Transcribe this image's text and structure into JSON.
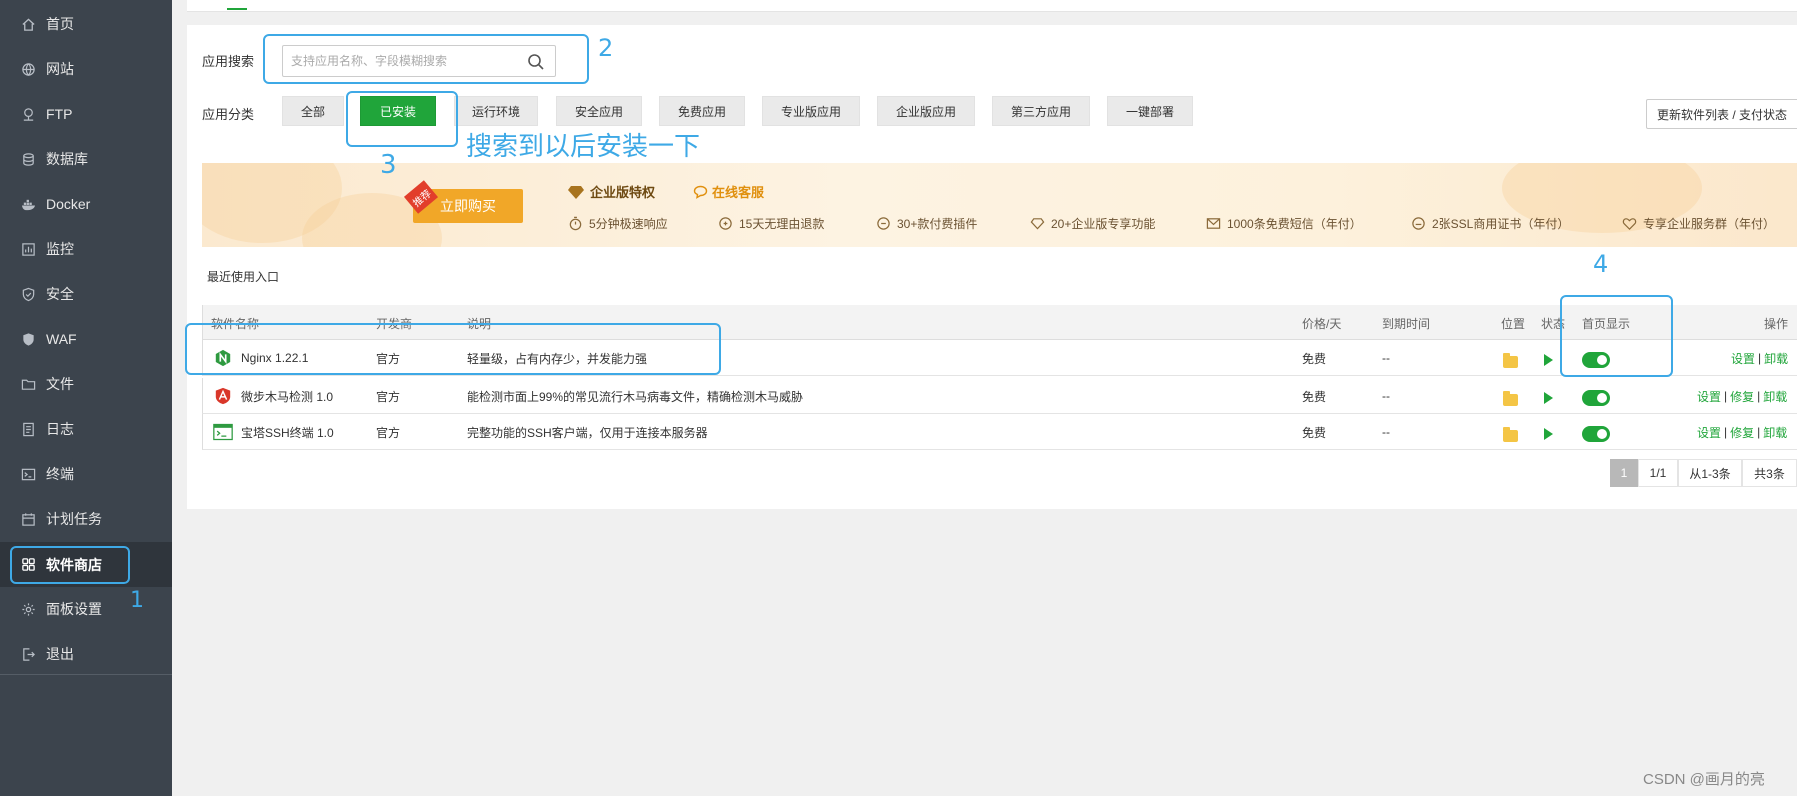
{
  "sidebar": {
    "items": [
      {
        "label": "首页",
        "icon": "home-icon"
      },
      {
        "label": "网站",
        "icon": "globe-icon"
      },
      {
        "label": "FTP",
        "icon": "ftp-icon"
      },
      {
        "label": "数据库",
        "icon": "database-icon"
      },
      {
        "label": "Docker",
        "icon": "docker-icon"
      },
      {
        "label": "监控",
        "icon": "monitor-icon"
      },
      {
        "label": "安全",
        "icon": "shield-icon"
      },
      {
        "label": "WAF",
        "icon": "waf-shield-icon"
      },
      {
        "label": "文件",
        "icon": "folder-icon"
      },
      {
        "label": "日志",
        "icon": "log-icon"
      },
      {
        "label": "终端",
        "icon": "terminal-icon"
      },
      {
        "label": "计划任务",
        "icon": "calendar-icon"
      },
      {
        "label": "软件商店",
        "icon": "grid-icon",
        "active": true
      },
      {
        "label": "面板设置",
        "icon": "gear-icon"
      },
      {
        "label": "退出",
        "icon": "logout-icon"
      }
    ]
  },
  "search": {
    "label": "应用搜索",
    "placeholder": "支持应用名称、字段模糊搜索"
  },
  "categories": {
    "label": "应用分类",
    "items": [
      "全部",
      "已安装",
      "运行环境",
      "安全应用",
      "免费应用",
      "专业版应用",
      "企业版应用",
      "第三方应用",
      "一键部署"
    ],
    "active": "已安装"
  },
  "update_button": "更新软件列表 / 支付状态",
  "banner": {
    "recommend_tag": "推荐",
    "buy_button": "立即购买",
    "title": "企业版特权",
    "service": "在线客服",
    "features": [
      "5分钟极速响应",
      "15天无理由退款",
      "30+款付费插件",
      "20+企业版专享功能",
      "1000条免费短信（年付）",
      "2张SSL商用证书（年付）",
      "专享企业服务群（年付）"
    ]
  },
  "recent_label": "最近使用入口",
  "table": {
    "headers": {
      "name": "软件名称",
      "developer": "开发商",
      "description": "说明",
      "price": "价格/天",
      "expire": "到期时间",
      "location": "位置",
      "status": "状态",
      "home_display": "首页显示",
      "actions": "操作"
    },
    "rows": [
      {
        "name": "Nginx 1.22.1",
        "developer": "官方",
        "description": "轻量级，占有内存少，并发能力强",
        "price": "免费",
        "expire": "--",
        "actions": [
          "设置",
          "卸载"
        ]
      },
      {
        "name": "微步木马检测 1.0",
        "developer": "官方",
        "description": "能检测市面上99%的常见流行木马病毒文件，精确检测木马威胁",
        "price": "免费",
        "expire": "--",
        "actions": [
          "设置",
          "修复",
          "卸载"
        ]
      },
      {
        "name": "宝塔SSH终端 1.0",
        "developer": "官方",
        "description": "完整功能的SSH客户端，仅用于连接本服务器",
        "price": "免费",
        "expire": "--",
        "actions": [
          "设置",
          "修复",
          "卸载"
        ]
      }
    ]
  },
  "pagination": {
    "current": "1",
    "pages": "1/1",
    "range": "从1-3条",
    "total": "共3条"
  },
  "annotations": {
    "step1": "1",
    "step2": "2",
    "step3": "3",
    "step4": "4",
    "note": "搜索到以后安装一下"
  },
  "watermark": "CSDN @画月的亮",
  "colors": {
    "sidebar_bg": "#3c444d",
    "accent_green": "#20a53a",
    "annotation_blue": "#3ea9e6",
    "buy_orange": "#f1a728"
  }
}
